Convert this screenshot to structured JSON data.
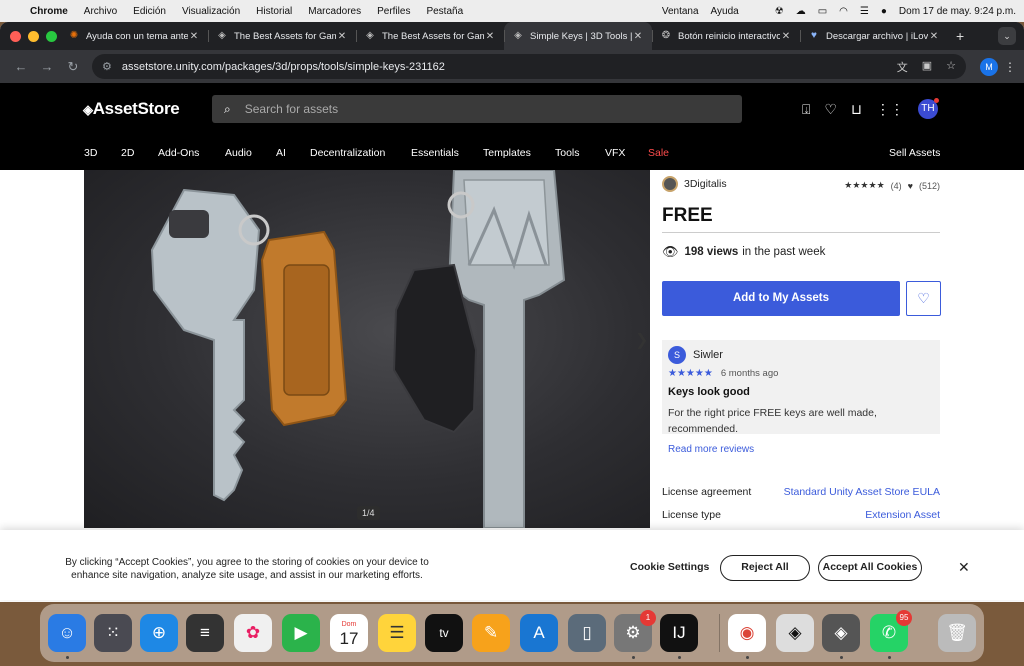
{
  "menubar": {
    "app": "Chrome",
    "items": [
      "Archivo",
      "Edición",
      "Visualización",
      "Historial",
      "Marcadores",
      "Perfiles",
      "Pestaña",
      "Ventana",
      "Ayuda"
    ],
    "clock": "Dom 17 de may.  9:24 p.m."
  },
  "tabs": [
    {
      "title": "Ayuda con un tema anter",
      "icon": "spark-icon"
    },
    {
      "title": "The Best Assets for Gam",
      "icon": "unity-icon"
    },
    {
      "title": "The Best Assets for Gam",
      "icon": "unity-icon"
    },
    {
      "title": "Simple Keys | 3D Tools |",
      "icon": "unity-icon"
    },
    {
      "title": "Botón reinicio interactivo",
      "icon": "chatgpt-icon"
    },
    {
      "title": "Descargar archivo | iLove",
      "icon": "ilovepdf-icon"
    }
  ],
  "browser": {
    "url": "assetstore.unity.com/packages/3d/props/tools/simple-keys-231162",
    "profile_initial": "M"
  },
  "store": {
    "logo": "AssetStore",
    "search_placeholder": "Search for assets",
    "user_initials": "TH",
    "categories": [
      "3D",
      "2D",
      "Add-Ons",
      "Audio",
      "AI",
      "Decentralization",
      "Essentials",
      "Templates",
      "Tools",
      "VFX",
      "Sale"
    ],
    "sell": "Sell Assets"
  },
  "product": {
    "publisher": "3Digitalis",
    "stars": "★★★★★",
    "rating_count": "(4)",
    "favorites": "(512)",
    "price": "FREE",
    "views_count": "198 views",
    "views_suffix": "in the past week",
    "add_button": "Add to My Assets",
    "image_counter": "1/4",
    "review": {
      "initial": "S",
      "author": "Siwler",
      "stars": "★★★★★",
      "ago": "6 months ago",
      "title": "Keys look good",
      "body": "For the right price FREE keys are well made, recommended."
    },
    "read_more": "Read more reviews",
    "license_agreement_label": "License agreement",
    "license_agreement_value": "Standard Unity Asset Store EULA",
    "license_type_label": "License type",
    "license_type_value": "Extension Asset"
  },
  "cookie": {
    "text": "By clicking “Accept Cookies”, you agree to the storing of cookies on your device to enhance site navigation, analyze site usage, and assist in our marketing efforts.",
    "settings": "Cookie Settings",
    "reject": "Reject All",
    "accept": "Accept All Cookies"
  },
  "dock": {
    "calendar_day": "Dom",
    "calendar_date": "17",
    "appletv": "tv",
    "settings_badge": "1",
    "whatsapp_badge": "95"
  },
  "colors": {
    "accent": "#3b5bdb",
    "sale": "#ff4d4d"
  }
}
